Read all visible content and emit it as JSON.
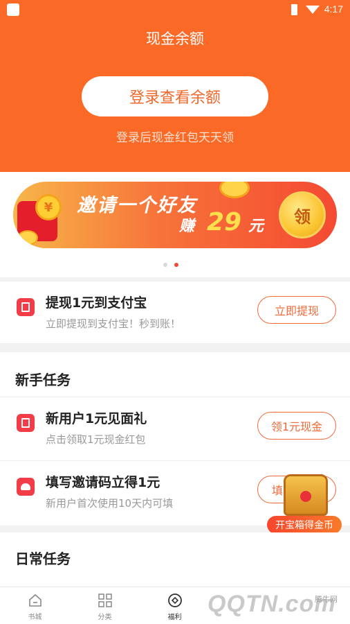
{
  "status_bar": {
    "time": "4:17"
  },
  "header": {
    "title": "现金余额",
    "login_button": "登录查看余额",
    "subtitle": "登录后现金红包天天领"
  },
  "banner": {
    "title": "邀请一个好友",
    "earn_label": "赚",
    "amount": "29",
    "unit": "元",
    "coin_symbol": "¥",
    "claim_label": "领",
    "slides_total": 2,
    "active_slide": 2
  },
  "withdraw": {
    "title": "提现1元到支付宝",
    "subtitle": "立即提现到支付宝！秒到账！",
    "button": "立即提现"
  },
  "newbie": {
    "section_title": "新手任务",
    "tasks": [
      {
        "title": "新用户1元见面礼",
        "subtitle": "点击领取1元现金红包",
        "button": "领1元现金",
        "icon": "red-envelope-icon"
      },
      {
        "title": "填写邀请码立得1元",
        "subtitle": "新用户首次使用10天内可填",
        "button": "填",
        "icon": "people-icon"
      }
    ]
  },
  "treasure": {
    "label": "开宝箱得金币"
  },
  "daily": {
    "section_title": "日常任务"
  },
  "tabbar": {
    "tabs": [
      {
        "label": "书城",
        "icon": "home-icon"
      },
      {
        "label": "分类",
        "icon": "grid-icon"
      },
      {
        "label": "福利",
        "icon": "welfare-icon",
        "active": true
      },
      {
        "label": "",
        "icon": "bookshelf-icon"
      },
      {
        "label": "",
        "icon": "profile-icon"
      }
    ]
  },
  "watermark": {
    "logo": "QQTN.com",
    "site_name": "腾牛网"
  },
  "colors": {
    "accent": "#fa6a26",
    "red": "#f23d48",
    "gold": "#fbc531"
  }
}
